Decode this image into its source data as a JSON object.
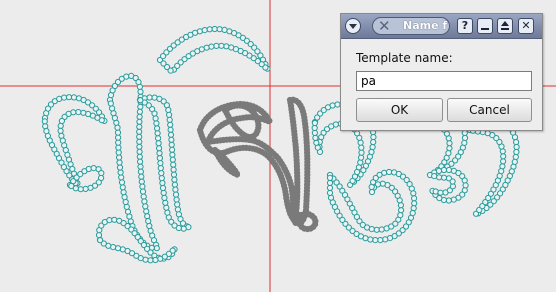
{
  "dialog": {
    "title": "Name f",
    "prompt_label": "Template name:",
    "template_name_value": "pa",
    "ok_label": "OK",
    "cancel_label": "Cancel",
    "help_glyph": "?"
  },
  "colors": {
    "canvas_background": "#ececec",
    "guide_line": "#e03030",
    "stroke_points_teal": "#2a9a9a",
    "stroke_points_grey": "#7a7a7a",
    "titlebar": "#7d89a6"
  },
  "icons": {
    "window_menu": "chevron-down-icon",
    "title_close": "x-icon",
    "help": "question-icon",
    "minimize": "minimize-icon",
    "maximize": "maximize-icon",
    "close": "close-icon"
  }
}
